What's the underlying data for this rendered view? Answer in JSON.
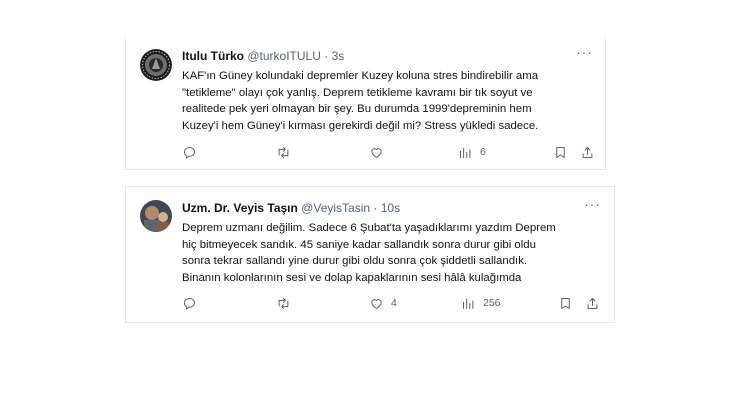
{
  "tweets": [
    {
      "author": {
        "name": "Itulu Türko",
        "handle": "@turkoITULU",
        "separator": "·",
        "time": "3s"
      },
      "text": "KAF'ın Güney kolundaki depremler Kuzey koluna stres bindirebilir ama\n\"tetikleme\" olayı çok yanlış. Deprem tetikleme kavramı bir tık soyut ve\nrealitede pek yeri olmayan bir şey. Bu durumda 1999'depreminin hem\nKuzey'i hem Güney'i kırması gerekirdi değil mi? Stress yükledi sadece.",
      "actions": {
        "reply": "",
        "retweet": "",
        "like": "",
        "views": "6"
      },
      "avatar_colors": [
        "#6e6e6e",
        "#1c1c1c"
      ]
    },
    {
      "author": {
        "name": "Uzm. Dr. Veyis Taşın",
        "handle": "@VeyisTasin",
        "separator": "·",
        "time": "10s"
      },
      "text": "Deprem uzmanı değilim. Sadece 6 Şubat'ta yaşadıklarımı yazdım Deprem\nhiç bitmeyecek sandık. 45 saniye kadar sallandık sonra durur gibi oldu\nsonra tekrar sallandı yine durur gibi oldu sonra çok şiddetli sallandık.\nBinanın kolonlarının sesi ve dolap kapaklarının sesi hâlâ kulağımda",
      "actions": {
        "reply": "",
        "retweet": "",
        "like": "4",
        "views": "256"
      },
      "avatar_colors": [
        "#b08a6a",
        "#3d4a55"
      ]
    }
  ],
  "icons": {
    "reply": "reply-icon",
    "retweet": "retweet-icon",
    "like": "heart-icon",
    "views": "views-icon",
    "bookmark": "bookmark-icon",
    "share": "share-icon",
    "more": "more-icon"
  },
  "colors": {
    "text": "#0f1419",
    "secondary": "#536471",
    "border": "#e1e8ed",
    "background": "#ffffff"
  }
}
